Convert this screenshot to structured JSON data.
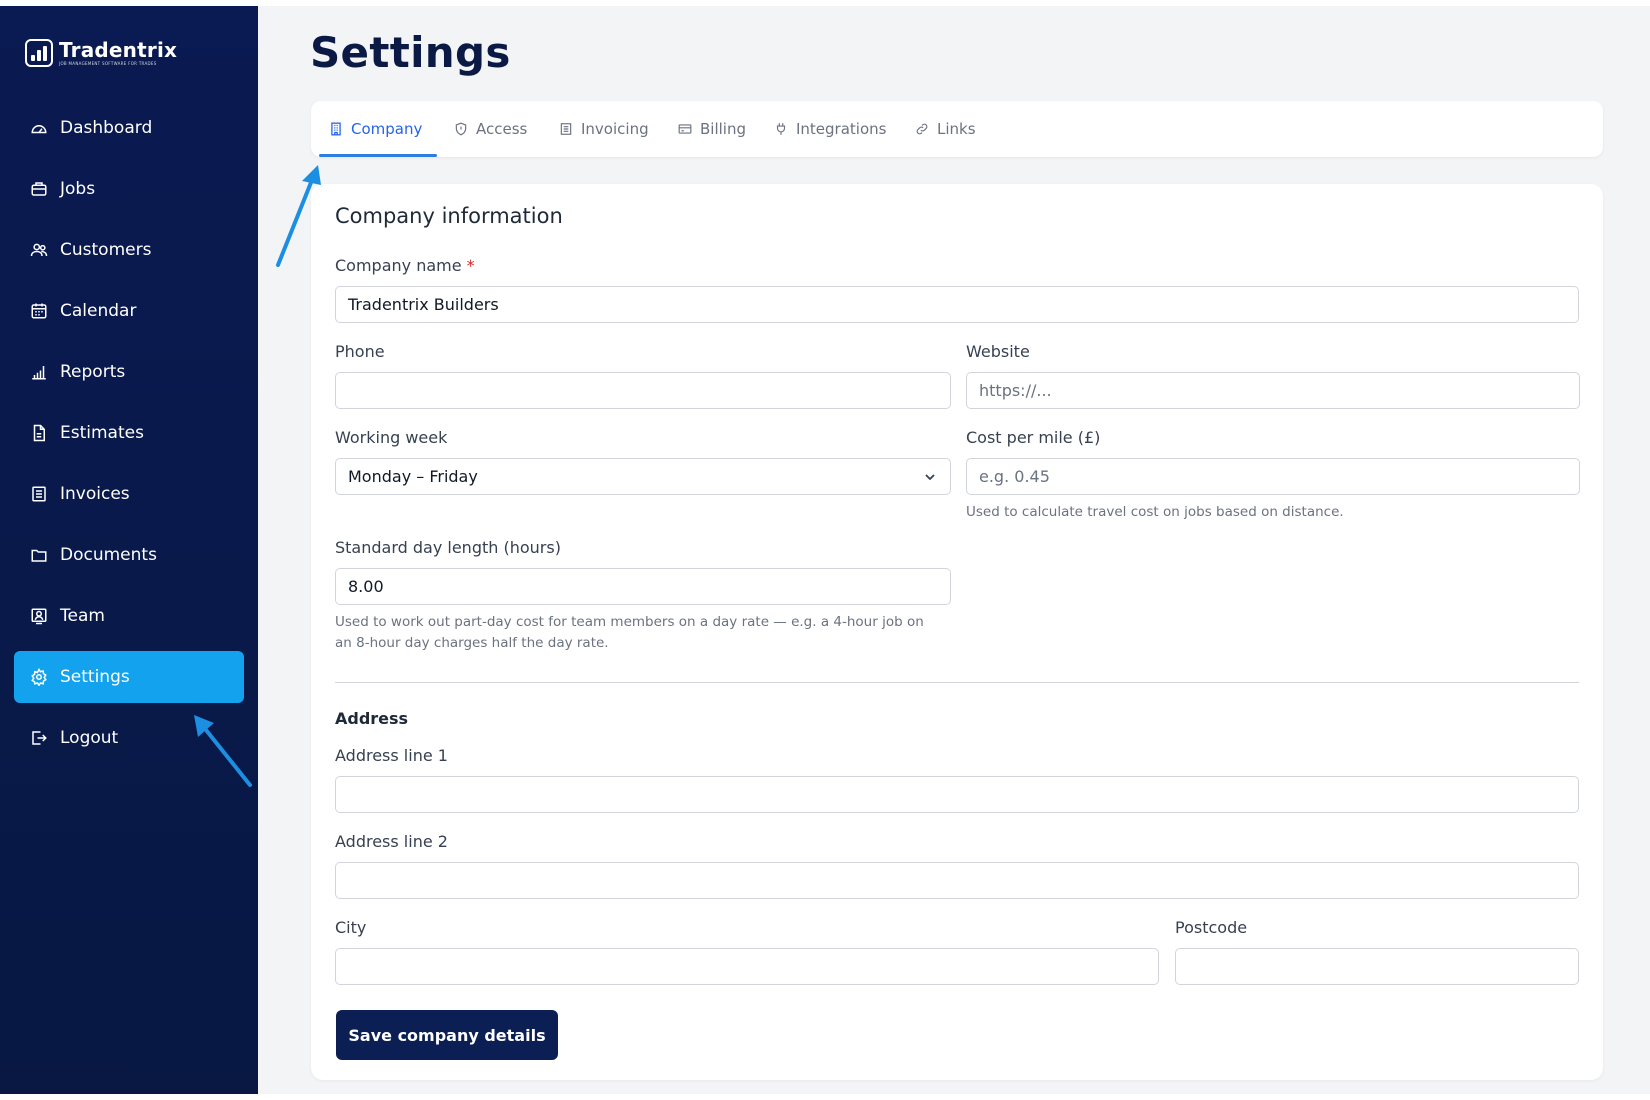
{
  "brand": {
    "name": "Tradentrix",
    "tagline": "JOB MANAGEMENT SOFTWARE FOR TRADES"
  },
  "sidebar": {
    "items": [
      {
        "label": "Dashboard",
        "icon": "dashboard-icon"
      },
      {
        "label": "Jobs",
        "icon": "briefcase-icon"
      },
      {
        "label": "Customers",
        "icon": "users-icon"
      },
      {
        "label": "Calendar",
        "icon": "calendar-icon"
      },
      {
        "label": "Reports",
        "icon": "bar-chart-icon"
      },
      {
        "label": "Estimates",
        "icon": "file-icon"
      },
      {
        "label": "Invoices",
        "icon": "invoice-icon"
      },
      {
        "label": "Documents",
        "icon": "folder-icon"
      },
      {
        "label": "Team",
        "icon": "team-icon"
      },
      {
        "label": "Settings",
        "icon": "gear-icon",
        "active": true
      },
      {
        "label": "Logout",
        "icon": "logout-icon"
      }
    ]
  },
  "page": {
    "title": "Settings"
  },
  "tabs": [
    {
      "label": "Company",
      "icon": "building-icon",
      "active": true
    },
    {
      "label": "Access",
      "icon": "shield-icon"
    },
    {
      "label": "Invoicing",
      "icon": "document-icon"
    },
    {
      "label": "Billing",
      "icon": "credit-card-icon"
    },
    {
      "label": "Integrations",
      "icon": "plug-icon"
    },
    {
      "label": "Links",
      "icon": "link-icon"
    }
  ],
  "form": {
    "section_title": "Company information",
    "company_name": {
      "label": "Company name",
      "required_mark": "*",
      "value": "Tradentrix Builders"
    },
    "phone": {
      "label": "Phone",
      "value": ""
    },
    "website": {
      "label": "Website",
      "placeholder": "https://..."
    },
    "working_week": {
      "label": "Working week",
      "value": "Monday – Friday"
    },
    "cost_per_mile": {
      "label": "Cost per mile (£)",
      "placeholder": "e.g. 0.45",
      "help": "Used to calculate travel cost on jobs based on distance."
    },
    "day_length": {
      "label": "Standard day length (hours)",
      "value": "8.00",
      "help_line1": "Used to work out part-day cost for team members on a day rate — e.g. a 4-hour job on",
      "help_line2": "an 8-hour day charges half the day rate."
    },
    "address": {
      "heading": "Address",
      "line1_label": "Address line 1",
      "line2_label": "Address line 2",
      "city_label": "City",
      "postcode_label": "Postcode"
    },
    "save_label": "Save company details"
  },
  "colors": {
    "sidebar": "#0a1a4a",
    "active": "#12a2ee",
    "primary_button": "#0b1f54",
    "tab_active": "#2563eb",
    "annotation_arrow": "#1d8fe3"
  }
}
